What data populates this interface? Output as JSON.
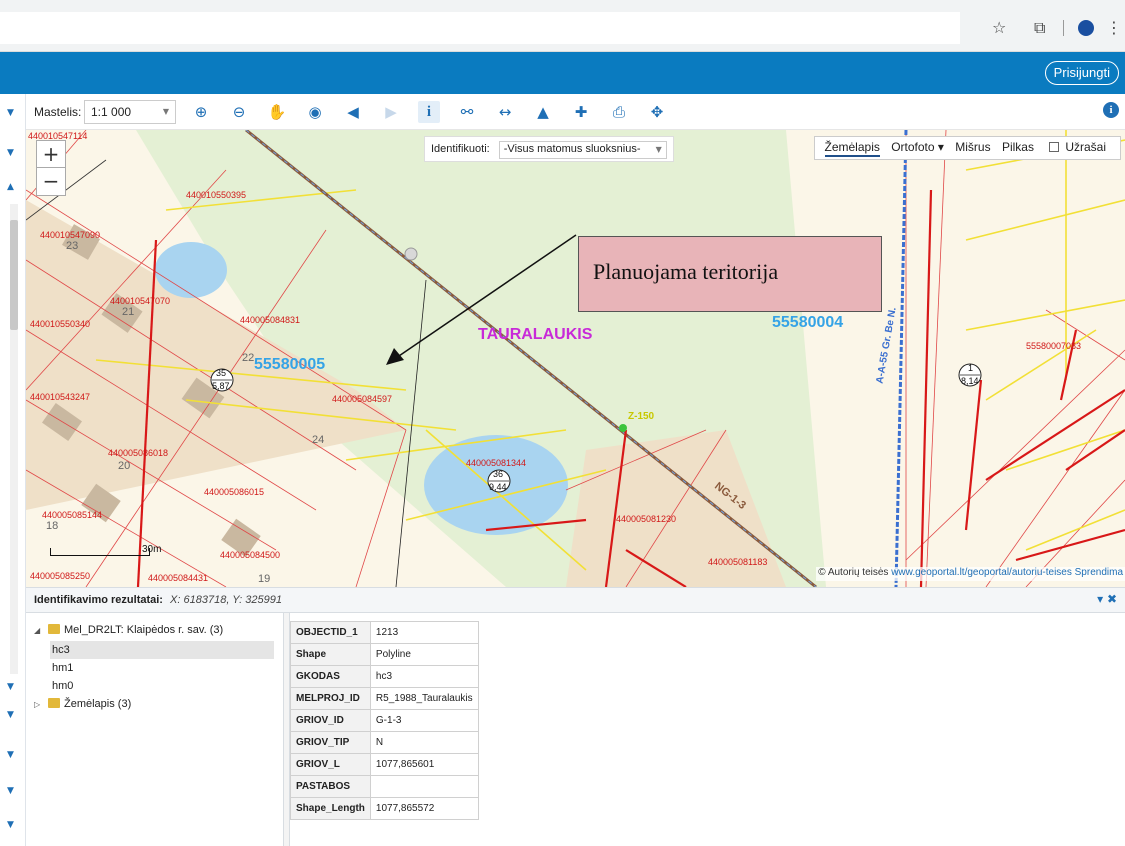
{
  "toolbar": {
    "scale_label": "Mastelis:",
    "scale_value": "1:1 000",
    "tools": [
      "zoom-in",
      "zoom-out",
      "pan",
      "full-extent",
      "previous-extent",
      "next-extent",
      "identify",
      "measure-area",
      "measure-distance",
      "profile",
      "add-data",
      "print",
      "locate"
    ]
  },
  "header": {
    "login_label": "Prisijungti"
  },
  "map": {
    "identify_label": "Identifikuoti:",
    "identify_value": "-Visus matomus sluoksnius-",
    "basemaps": [
      "Žemėlapis",
      "Ortofoto ▾",
      "Mišrus",
      "Pilkas"
    ],
    "notes_label": "Užrašai",
    "attribution_prefix": "© Autorių teisės",
    "attribution_link": "www.geoportal.lt/geoportal/autoriu-teises",
    "attribution_suffix": "Sprendima",
    "scalebar_label": "30m",
    "annotation": "Planuojama teritorija",
    "place_name": "TAURALAUKIS",
    "big_labels": [
      "55580005",
      "55580004"
    ],
    "labels": {
      "l1": "440010547114",
      "l2": "440010550395",
      "l3": "440010547090",
      "l4": "440010547070",
      "l5": "440010550340",
      "l6": "440005084831",
      "l7": "440010543247",
      "l8": "440005084597",
      "l9": "440005086018",
      "l10": "440005086015",
      "l11": "440005085144",
      "l12": "440005084500",
      "l13": "440005085250",
      "l14": "440005084431",
      "l15": "440005081344",
      "l16": "440005081230",
      "l17": "440005081183",
      "l18": "55580007083",
      "l19": "Z-150",
      "l20": "NG-1-3",
      "l21": "A-A-55 Gr. Be N.",
      "n23": "23",
      "n21": "21",
      "n22": "22",
      "n24": "24",
      "n20": "20",
      "n18": "18",
      "n19": "19",
      "c1t": "35",
      "c1b": "5,87",
      "c2t": "36",
      "c2b": "9,44",
      "c3t": "1",
      "c3b": "8,14"
    }
  },
  "results": {
    "title": "Identifikavimo rezultatai:",
    "coord": "X: 6183718, Y: 325991",
    "tree": {
      "root": "Mel_DR2LT: Klaipėdos r. sav. (3)",
      "children": [
        "hc3",
        "hm1",
        "hm0"
      ],
      "second": "Žemėlapis (3)"
    },
    "attributes": [
      {
        "key": "OBJECTID_1",
        "value": "1213"
      },
      {
        "key": "Shape",
        "value": "Polyline"
      },
      {
        "key": "GKODAS",
        "value": "hc3"
      },
      {
        "key": "MELPROJ_ID",
        "value": "R5_1988_Tauralaukis"
      },
      {
        "key": "GRIOV_ID",
        "value": "G-1-3"
      },
      {
        "key": "GRIOV_TIP",
        "value": "N"
      },
      {
        "key": "GRIOV_L",
        "value": "1077,865601"
      },
      {
        "key": "PASTABOS",
        "value": ""
      },
      {
        "key": "Shape_Length",
        "value": "1077,865572"
      }
    ]
  }
}
